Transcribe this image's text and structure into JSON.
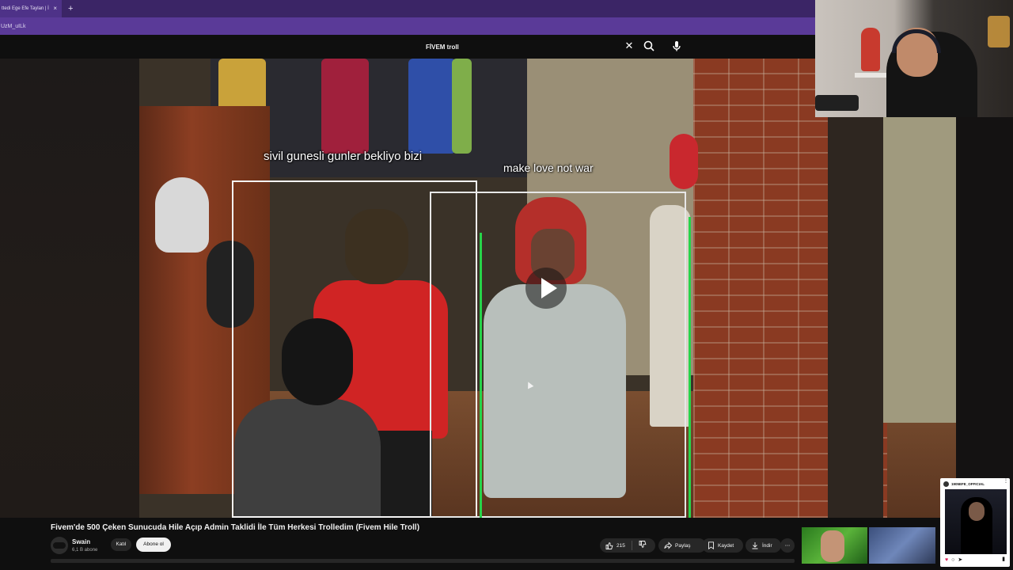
{
  "browser": {
    "tab_title": "ttedi Ege Efe Taylan | İ",
    "tab_close": "×",
    "new_tab": "+",
    "url_text": "UzM_uILk"
  },
  "youtube": {
    "search_query": "FİVEM troll",
    "clear_icon": "close-icon",
    "search_icon": "search-icon",
    "mic_icon": "mic-icon"
  },
  "video": {
    "overlay_text_1": "sivil gunesli gunler bekliyo bizi",
    "overlay_text_2": "make love not war",
    "play_icon": "play-icon"
  },
  "meta": {
    "title": "Fivem'de 500 Çeken Sunucuda Hile Açıp Admin Taklidi İle Tüm Herkesi Trolledim (Fivem Hile Troll)",
    "channel_name": "Swain",
    "subscriber_count": "6,1 B abone",
    "join_label": "Katıl",
    "subscribe_label": "Abone ol",
    "like_count": "215",
    "share_label": "Paylaş",
    "save_label": "Kaydet",
    "download_label": "İndir",
    "more_label": "⋯"
  },
  "instagram": {
    "account_name": "1905EFE_OFFICIAL",
    "more_label": "⋮"
  },
  "colors": {
    "tab_bar": "#3b2566",
    "url_bar": "#5a3a98",
    "page_bg": "#0f0f0f",
    "button_bg": "#272727",
    "subscribe_bg": "#f1f1f1"
  }
}
